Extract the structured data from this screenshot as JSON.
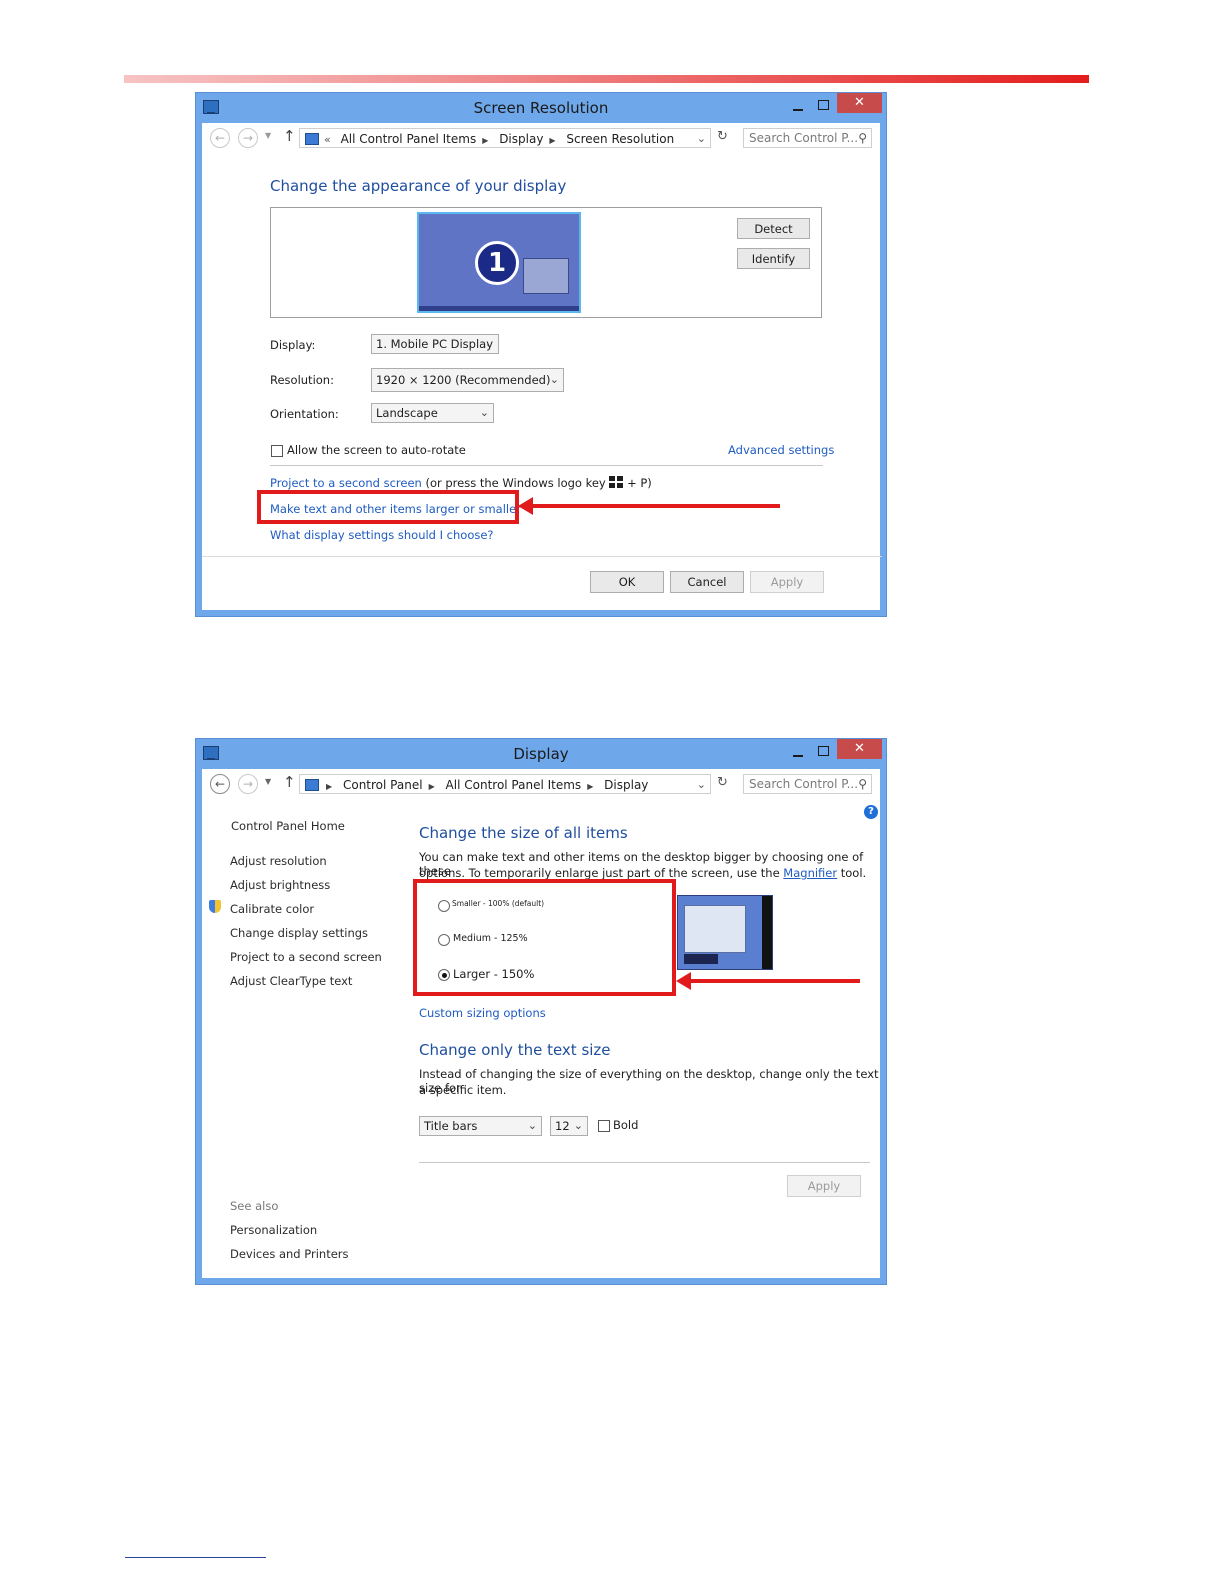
{
  "window1": {
    "title": "Screen Resolution",
    "close": "✕",
    "address": [
      "All Control Panel Items",
      "Display",
      "Screen Resolution"
    ],
    "address_prefix": "«",
    "search_placeholder": "Search Control P...",
    "heading": "Change the appearance of your display",
    "monitor_number": "1",
    "detect_label": "Detect",
    "identify_label": "Identify",
    "display_label": "Display:",
    "display_value": "1. Mobile PC Display",
    "resolution_label": "Resolution:",
    "resolution_value": "1920 × 1200 (Recommended)",
    "orientation_label": "Orientation:",
    "orientation_value": "Landscape",
    "autorotate_label": "Allow the screen to auto-rotate",
    "advanced_link": "Advanced settings",
    "project_link": "Project to a second screen",
    "project_suffix_a": "(or press the Windows logo key",
    "project_suffix_b": "+ P)",
    "make_text_link": "Make text and other items larger or smaller",
    "what_settings_link": "What display settings should I choose?",
    "ok_label": "OK",
    "cancel_label": "Cancel",
    "apply_label": "Apply"
  },
  "window2": {
    "title": "Display",
    "close": "✕",
    "address": [
      "Control Panel",
      "All Control Panel Items",
      "Display"
    ],
    "search_placeholder": "Search Control P...",
    "help": "?",
    "sidebar": {
      "home": "Control Panel Home",
      "items": [
        "Adjust resolution",
        "Adjust brightness",
        "Calibrate color",
        "Change display settings",
        "Project to a second screen",
        "Adjust ClearType text"
      ],
      "see_also": "See also",
      "see_also_items": [
        "Personalization",
        "Devices and Printers"
      ]
    },
    "heading1": "Change the size of all items",
    "desc1_a": "You can make text and other items on the desktop bigger by choosing one of these",
    "desc1_b": "options. To temporarily enlarge just part of the screen, use the",
    "magnifier_link": "Magnifier",
    "desc1_c": "tool.",
    "options": [
      "Smaller - 100% (default)",
      "Medium - 125%",
      "Larger - 150%"
    ],
    "selected_option": "Larger - 150%",
    "custom_link": "Custom sizing options",
    "heading2": "Change only the text size",
    "desc2_a": "Instead of changing the size of everything on the desktop, change only the text size for",
    "desc2_b": "a specific item.",
    "item_value": "Title bars",
    "size_value": "12",
    "bold_label": "Bold",
    "apply_label": "Apply"
  },
  "colors": {
    "accent_red": "#e11b1b",
    "title_bar": "#6ea7ea",
    "link_blue": "#1e5bc2"
  }
}
